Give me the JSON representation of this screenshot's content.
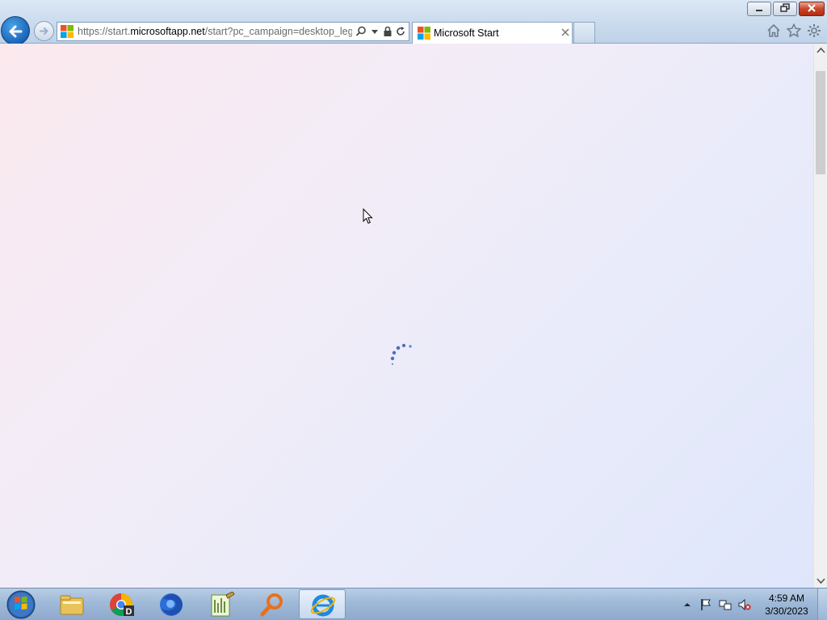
{
  "window": {
    "minimize_label": "Minimize",
    "restore_label": "Restore",
    "close_label": "Close"
  },
  "address_bar": {
    "url_prefix": "https://start.",
    "url_host": "microsoftapp.net",
    "url_suffix": "/start?pc_campaign=desktop_lega"
  },
  "tabs": [
    {
      "title": "Microsoft Start",
      "active": true
    }
  ],
  "toolbar_icons": [
    "home-icon",
    "favorites-star-icon",
    "tools-gear-icon"
  ],
  "page": {
    "state": "loading",
    "background_colors": [
      "#fbe9ee",
      "#f3ecf7",
      "#e9ebfa",
      "#dfe6fb"
    ],
    "spinner_color": "#4a6fc1"
  },
  "taskbar": {
    "pinned": [
      "file-explorer-icon",
      "chrome-icon",
      "firefox-icon",
      "notepad-icon",
      "search-magnifier-icon",
      "internet-explorer-icon"
    ],
    "active_app": "internet-explorer-icon"
  },
  "tray": {
    "icons": [
      "show-hidden-icons-arrow",
      "action-center-flag-icon",
      "network-icon",
      "volume-muted-icon"
    ],
    "time": "4:59 AM",
    "date": "3/30/2023"
  },
  "colors": {
    "accent": "#1a64b8",
    "close_red": "#c9452b",
    "taskbar": "#9fb9d8"
  }
}
